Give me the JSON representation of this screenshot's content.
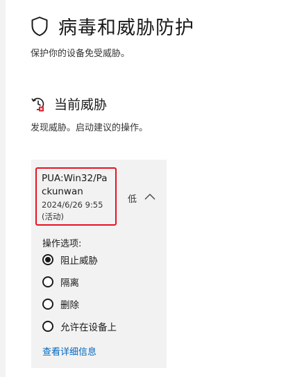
{
  "page": {
    "title": "病毒和威胁防护",
    "subtitle": "保护你的设备免受威胁。"
  },
  "current_threats": {
    "title": "当前威胁",
    "subtitle": "发现威胁。启动建议的操作。"
  },
  "threat": {
    "name": "PUA:Win32/Packunwan",
    "date": "2024/6/26 9:55 (活动)",
    "severity": "低",
    "options_label": "操作选项:",
    "options": [
      {
        "label": "阻止威胁",
        "selected": true
      },
      {
        "label": "隔离",
        "selected": false
      },
      {
        "label": "删除",
        "selected": false
      },
      {
        "label": "允许在设备上",
        "selected": false
      }
    ],
    "details_link": "查看详细信息"
  },
  "icons": {
    "page": "shield-icon",
    "section": "threat-scan-icon",
    "collapse": "chevron-up-icon"
  },
  "colors": {
    "highlight_border": "#e81123",
    "link": "#0067c0",
    "card_background": "#f2f2f2"
  }
}
